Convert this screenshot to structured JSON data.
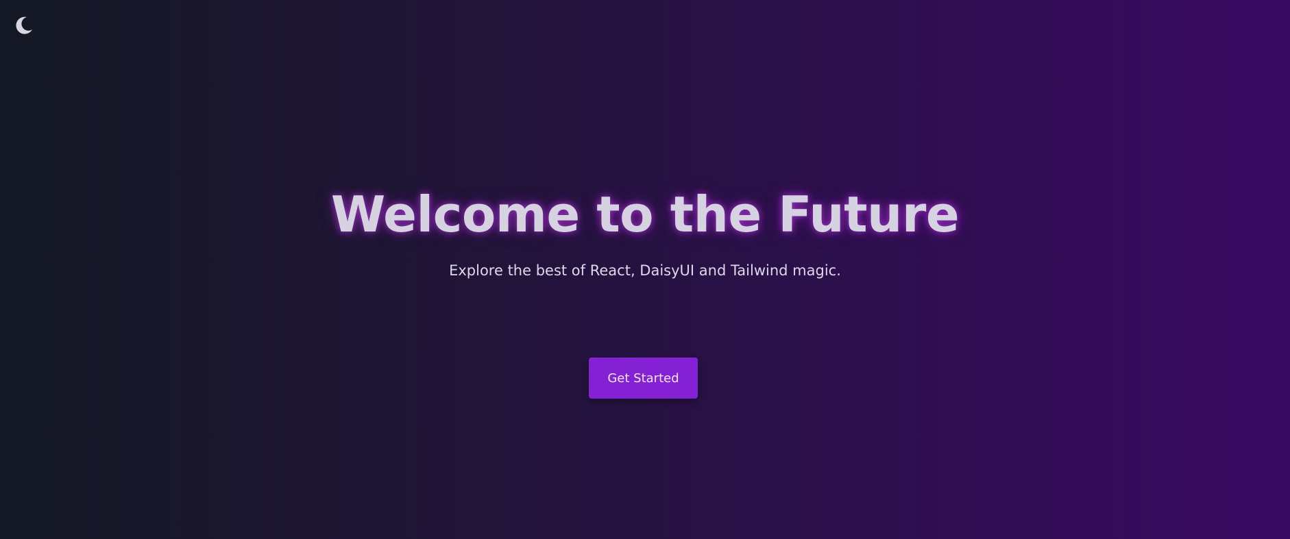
{
  "theme_toggle": {
    "icon": "moon-icon",
    "color": "#d9d6e2"
  },
  "hero": {
    "title": "Welcome to the Future",
    "subtitle": "Explore the best of React, DaisyUI and Tailwind magic.",
    "cta_label": "Get Started"
  },
  "colors": {
    "background_start": "#141824",
    "background_end": "#3a0b63",
    "accent": "#8421d4",
    "title_glow": "#be3ce6"
  }
}
